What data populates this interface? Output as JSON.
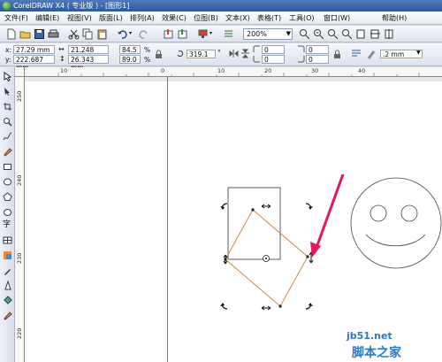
{
  "window": {
    "title": "CorelDRAW X4 ( 专业版 ) - [图形1]"
  },
  "menu": {
    "items": [
      "文件(F)",
      "编辑(E)",
      "视图(V)",
      "版面(L)",
      "排列(A)",
      "效果(C)",
      "位图(B)",
      "文本(X)",
      "表格(T)",
      "工具(O)",
      "窗口(W)",
      "帮助(H)"
    ]
  },
  "toolbar": {
    "zoom": "200%"
  },
  "propbar": {
    "x_label": "x:",
    "x_value": "27.29 mm",
    "y_label": "y:",
    "y_value": "222.687 mm",
    "w_value": "21.248 mm",
    "h_value": "26.343 mm",
    "sx_value": "84.5",
    "sy_value": "89.0",
    "pct": "%",
    "angle": "319.1",
    "angle_unit": "°",
    "n1": "0",
    "n2": "0",
    "n3": "0",
    "n4": "0",
    "outline": ".2 mm"
  },
  "ruler": {
    "h": [
      "10",
      "0",
      "10",
      "20",
      "30",
      "40"
    ],
    "v": [
      "250",
      "240",
      "230",
      "220"
    ]
  },
  "watermark": {
    "line1": "jb51.net",
    "line2": "脚本之家"
  },
  "colors": {
    "title_bar": "#2e5a9c",
    "arrow": "#e4195a",
    "rotated_rect": "#c48a45",
    "accent": "#2d7bc0"
  }
}
